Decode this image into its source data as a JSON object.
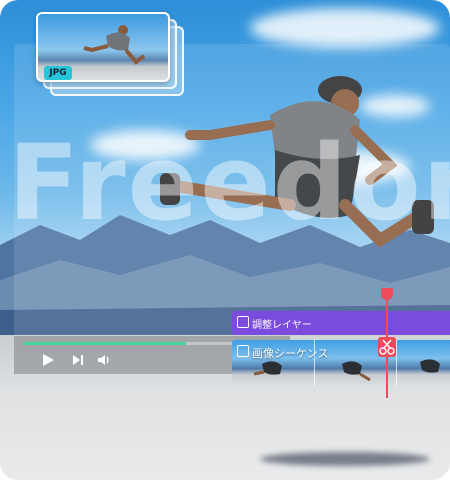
{
  "preview": {
    "watermark_text": "Freedom",
    "accent_progress": "#46d49a",
    "progress_fraction": 0.62
  },
  "thumbnail": {
    "badge": "JPG",
    "badge_color": "#27c5d8"
  },
  "controls": {
    "play_icon": "play-icon",
    "next_icon": "skip-next-icon",
    "volume_icon": "volume-icon"
  },
  "timeline": {
    "adjustment_layer_label": "調整レイヤー",
    "adjustment_layer_color": "#7a4bdc",
    "image_sequence_label": "画像シーケンス",
    "playhead_color": "#ee4b5a",
    "cut_icon": "scissors-icon"
  }
}
